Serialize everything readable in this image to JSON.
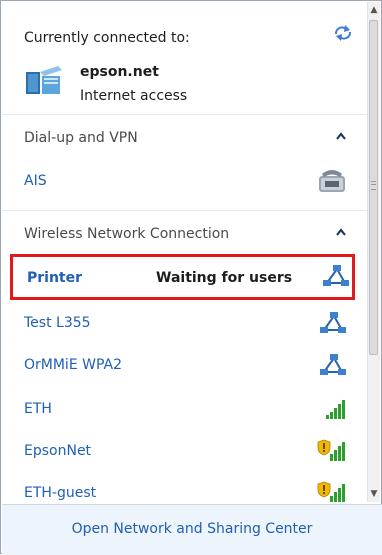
{
  "connected": {
    "title": "Currently connected to:",
    "network_name": "epson.net",
    "network_status": "Internet access"
  },
  "sections": {
    "dialup": {
      "label": "Dial-up and VPN"
    },
    "wireless": {
      "label": "Wireless Network Connection"
    }
  },
  "dialup_items": [
    {
      "label": "AIS",
      "icon": "modem-phone-icon"
    }
  ],
  "printer_row": {
    "label": "Printer",
    "status": "Waiting for users",
    "icon": "adhoc-network-icon"
  },
  "wireless_items": [
    {
      "label": "Test L355",
      "icon": "adhoc-network-icon"
    },
    {
      "label": "OrMMiE WPA2",
      "icon": "adhoc-network-icon"
    },
    {
      "label": "ETH",
      "icon": "signal-strength-icon",
      "signal": "full"
    },
    {
      "label": "EpsonNet",
      "icon": "signal-shield-icon",
      "signal": "full",
      "secured_warning": true
    },
    {
      "label": "ETH-guest",
      "icon": "signal-shield-icon",
      "signal": "full",
      "secured_warning": true
    }
  ],
  "footer": {
    "link_label": "Open Network and Sharing Center"
  },
  "colors": {
    "link": "#1f5fb4",
    "highlight": "#e01a1a",
    "footer_bg": "#eef4fb"
  }
}
